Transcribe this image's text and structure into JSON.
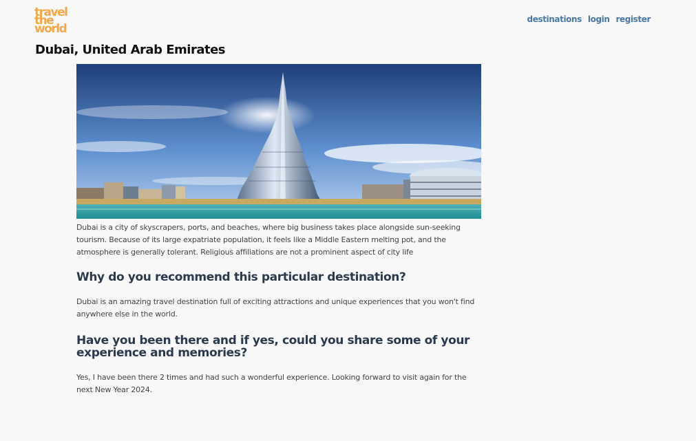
{
  "header": {
    "logo_lines": [
      "travel",
      "the",
      "world"
    ],
    "nav": {
      "destinations": "destinations",
      "login": "login",
      "register": "register"
    }
  },
  "destination": {
    "title": "Dubai, United Arab Emirates",
    "image_alt": "Burj Khalifa, Dubai skyline",
    "description": "Dubai is a city of skyscrapers, ports, and beaches, where big business takes place alongside sun-seeking tourism. Because of its large expatriate population, it feels like a Middle Eastern melting pot, and the atmosphere is generally tolerant. Religious affiliations are not a prominent aspect of city life",
    "q1": "Why do you recommend this particular destination?",
    "a1": "Dubai is an amazing travel destination full of exciting attractions and unique experiences that you won't find anywhere else in the world.",
    "q2": "Have you been there and if yes, could you share some of your experience and memories?",
    "a2": "Yes, I have been there 2 times and had such a wonderful experience. Looking forward to visit again for the next New Year 2024."
  },
  "colors": {
    "logo": "#f2a94a",
    "nav_link": "#4a78a8",
    "heading": "#2b3a4d",
    "background": "#f8f8f8"
  }
}
